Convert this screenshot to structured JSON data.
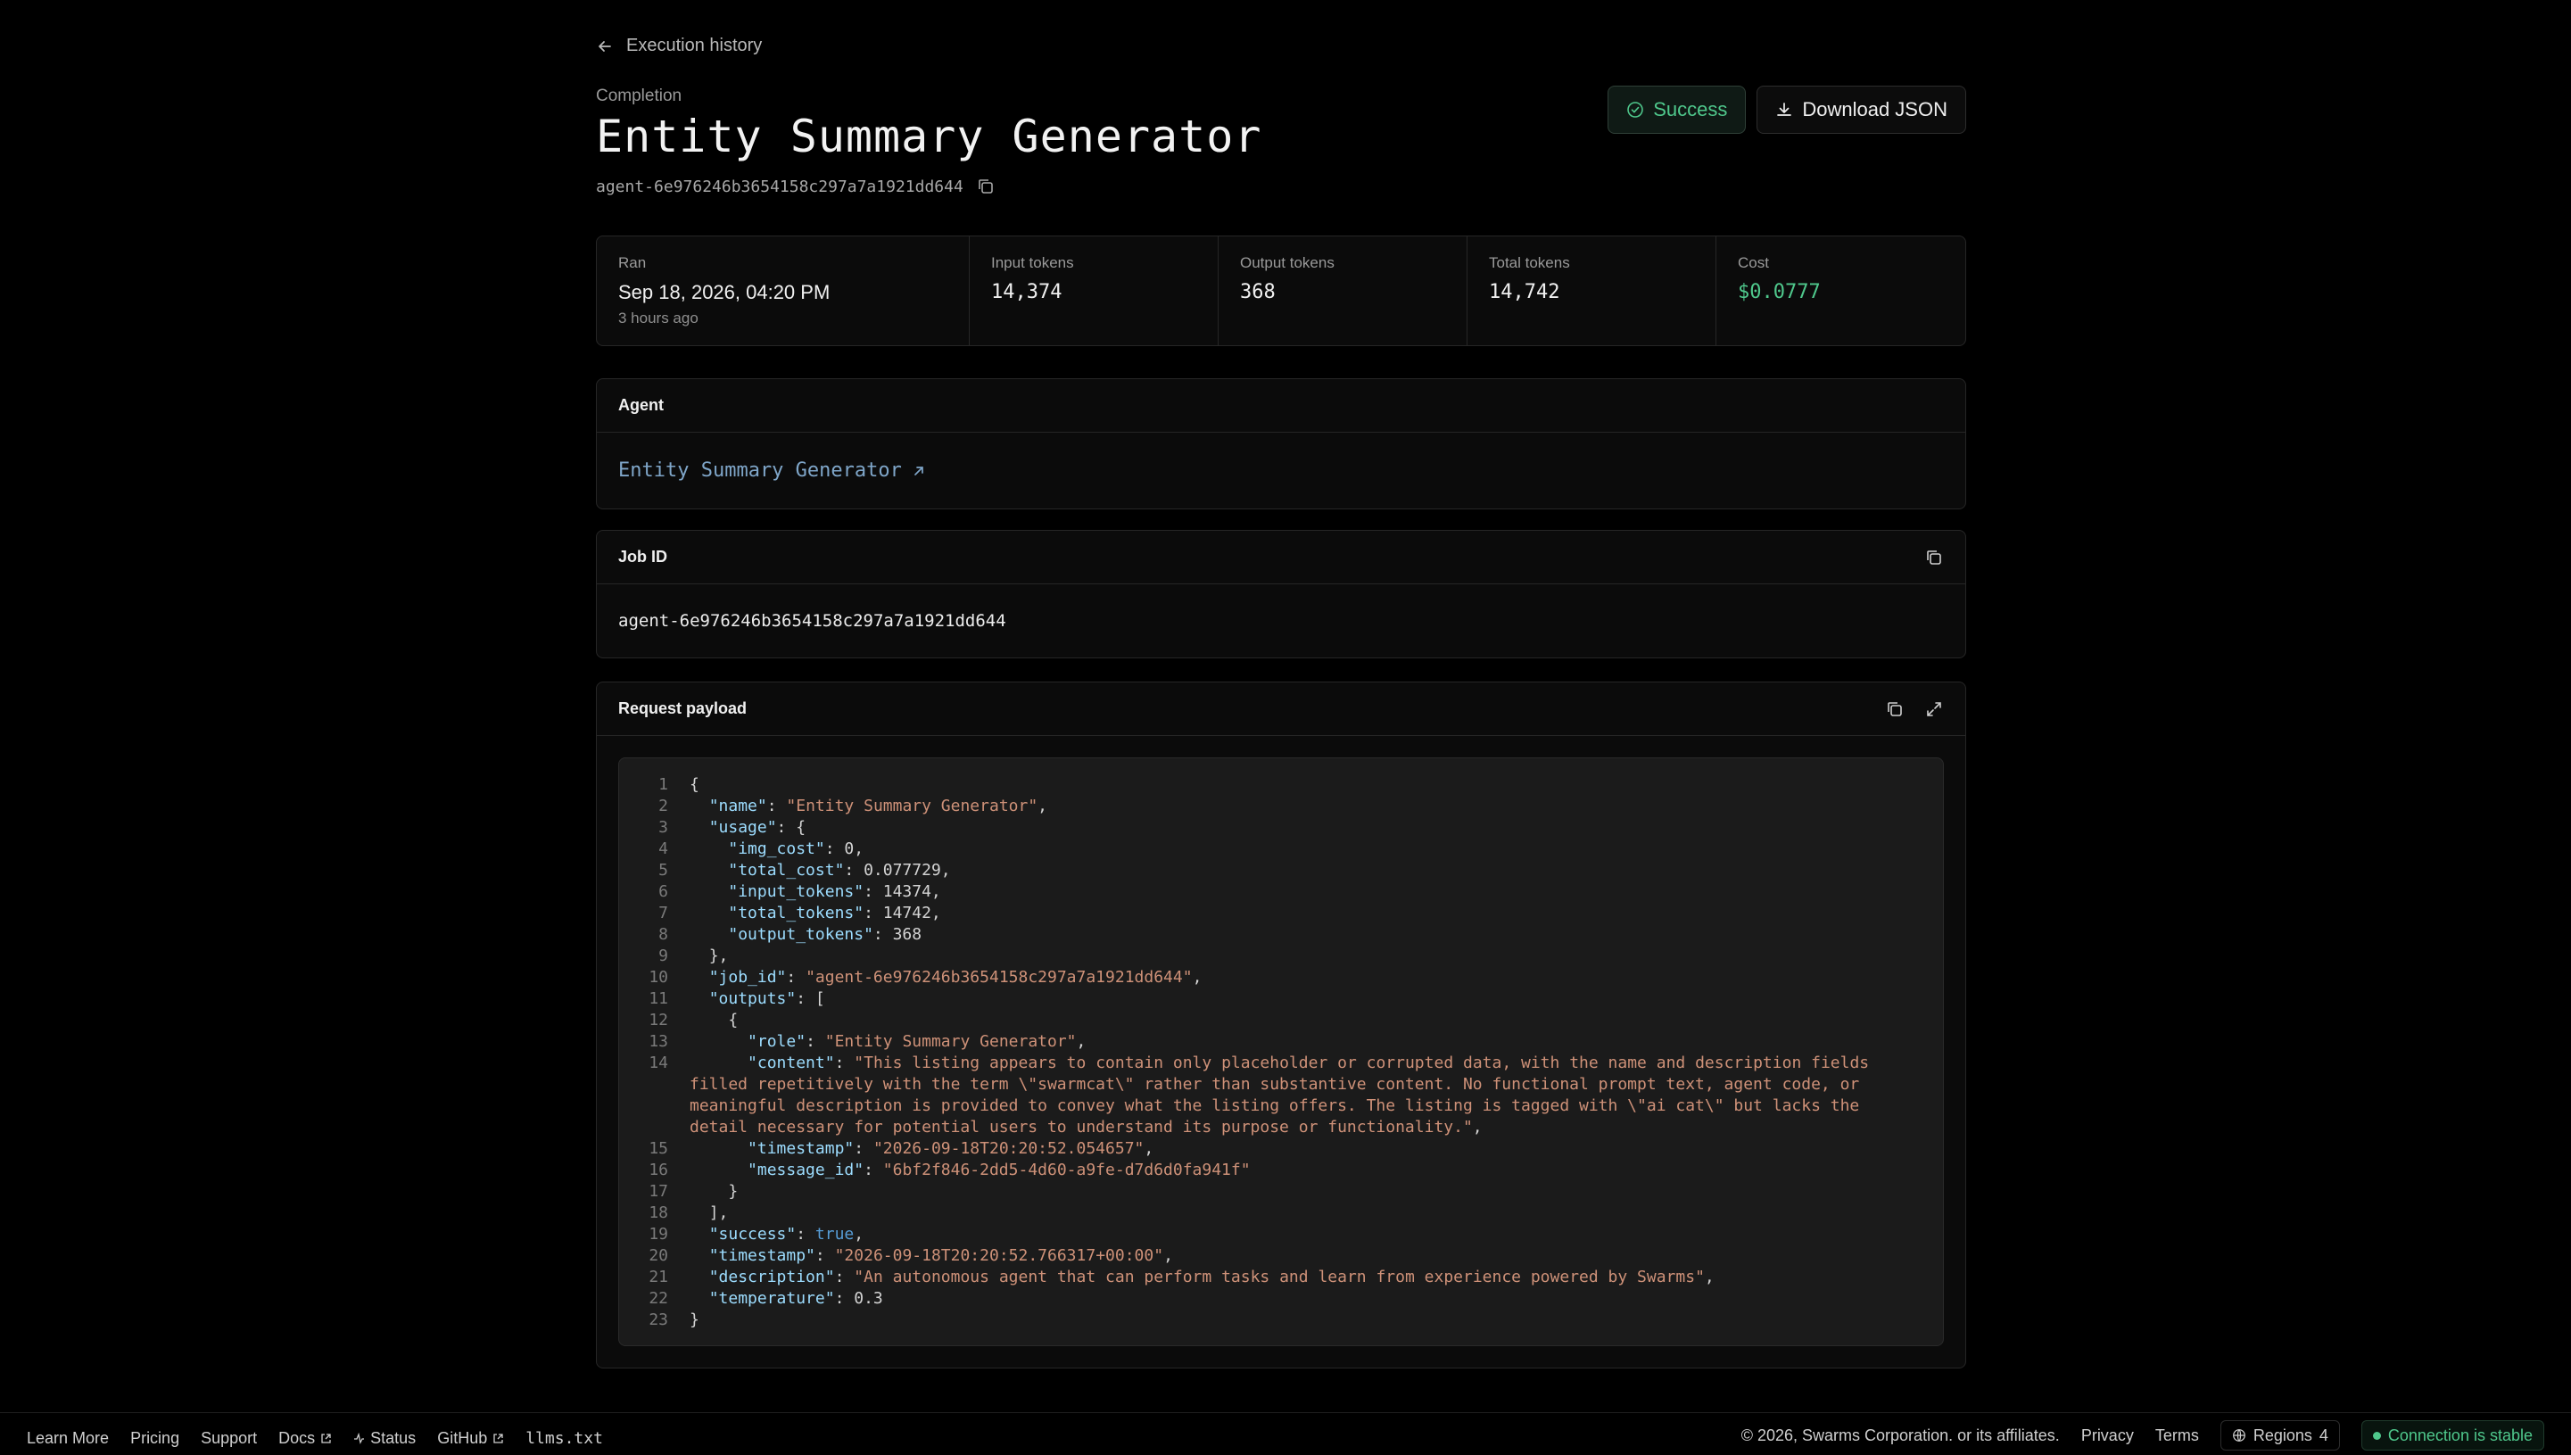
{
  "nav": {
    "back_label": "Execution history"
  },
  "header": {
    "eyebrow": "Completion",
    "title": "Entity Summary Generator",
    "agent_id": "agent-6e976246b3654158c297a7a1921dd644",
    "status_label": "Success",
    "download_label": "Download JSON"
  },
  "stats": {
    "ran_label": "Ran",
    "ran_value": "Sep 18, 2026, 04:20 PM",
    "ran_sub": "3 hours ago",
    "input_label": "Input tokens",
    "input_value": "14,374",
    "output_label": "Output tokens",
    "output_value": "368",
    "total_label": "Total tokens",
    "total_value": "14,742",
    "cost_label": "Cost",
    "cost_value": "$0.0777"
  },
  "agent_card": {
    "title": "Agent",
    "link_label": "Entity Summary Generator"
  },
  "job_card": {
    "title": "Job ID",
    "value": "agent-6e976246b3654158c297a7a1921dd644"
  },
  "payload_card": {
    "title": "Request payload",
    "lines": [
      {
        "n": "1",
        "t": "{"
      },
      {
        "n": "2",
        "k": "\"name\"",
        "t": ": ",
        "s": "\"Entity Summary Generator\"",
        "e": ","
      },
      {
        "n": "3",
        "k": "\"usage\"",
        "t": ": {"
      },
      {
        "n": "4",
        "k": "\"img_cost\"",
        "t": ": 0,",
        "indent": 2
      },
      {
        "n": "5",
        "k": "\"total_cost\"",
        "t": ": 0.077729,",
        "indent": 2
      },
      {
        "n": "6",
        "k": "\"input_tokens\"",
        "t": ": 14374,",
        "indent": 2
      },
      {
        "n": "7",
        "k": "\"total_tokens\"",
        "t": ": 14742,",
        "indent": 2
      },
      {
        "n": "8",
        "k": "\"output_tokens\"",
        "t": ": 368",
        "indent": 2
      },
      {
        "n": "9",
        "t": "},",
        "indent": 1
      },
      {
        "n": "10",
        "k": "\"job_id\"",
        "t": ": ",
        "s": "\"agent-6e976246b3654158c297a7a1921dd644\"",
        "e": ","
      },
      {
        "n": "11",
        "k": "\"outputs\"",
        "t": ": ["
      },
      {
        "n": "12",
        "t": "{",
        "indent": 2
      },
      {
        "n": "13",
        "k": "\"role\"",
        "t": ": ",
        "s": "\"Entity Summary Generator\"",
        "e": ",",
        "indent": 3
      },
      {
        "n": "14",
        "k": "\"content\"",
        "t": ": ",
        "s": "\"This listing appears to contain only placeholder or corrupted data, with the name and description fields filled repetitively with the term \\\"swarmcat\\\" rather than substantive content. No functional prompt text, agent code, or meaningful description is provided to convey what the listing offers. The listing is tagged with \\\"ai cat\\\" but lacks the detail necessary for potential users to understand its purpose or functionality.\"",
        "e": ",",
        "indent": 3
      },
      {
        "n": "15",
        "k": "\"timestamp\"",
        "t": ": ",
        "s": "\"2026-09-18T20:20:52.054657\"",
        "e": ",",
        "indent": 3
      },
      {
        "n": "16",
        "k": "\"message_id\"",
        "t": ": ",
        "s": "\"6bf2f846-2dd5-4d60-a9fe-d7d6d0fa941f\"",
        "indent": 3
      },
      {
        "n": "17",
        "t": "}",
        "indent": 2
      },
      {
        "n": "18",
        "t": "],",
        "indent": 1
      },
      {
        "n": "19",
        "k": "\"success\"",
        "t": ": ",
        "b": "true",
        "e": ","
      },
      {
        "n": "20",
        "k": "\"timestamp\"",
        "t": ": ",
        "s": "\"2026-09-18T20:20:52.766317+00:00\"",
        "e": ","
      },
      {
        "n": "21",
        "k": "\"description\"",
        "t": ": ",
        "s": "\"An autonomous agent that can perform tasks and learn from experience powered by Swarms\"",
        "e": ","
      },
      {
        "n": "22",
        "k": "\"temperature\"",
        "t": ": 0.3"
      },
      {
        "n": "23",
        "t": "}"
      }
    ]
  },
  "footer": {
    "learn_more": "Learn More",
    "pricing": "Pricing",
    "support": "Support",
    "docs": "Docs",
    "status": "Status",
    "github": "GitHub",
    "llms": "llms.txt",
    "copyright": "© 2026, Swarms Corporation. or its affiliates.",
    "privacy": "Privacy",
    "terms": "Terms",
    "regions_label": "Regions",
    "regions_count": "4",
    "connection": "Connection is stable"
  },
  "colors": {
    "success": "#4fc88c",
    "link": "#7fa6c9",
    "json_key": "#9cdcfe",
    "json_string": "#ce9178",
    "json_bool": "#569cd6"
  },
  "icons": [
    "arrow-left-icon",
    "copy-icon",
    "check-circle-icon",
    "download-icon",
    "external-arrow-icon",
    "expand-icon",
    "external-link-icon",
    "activity-icon",
    "globe-icon"
  ]
}
